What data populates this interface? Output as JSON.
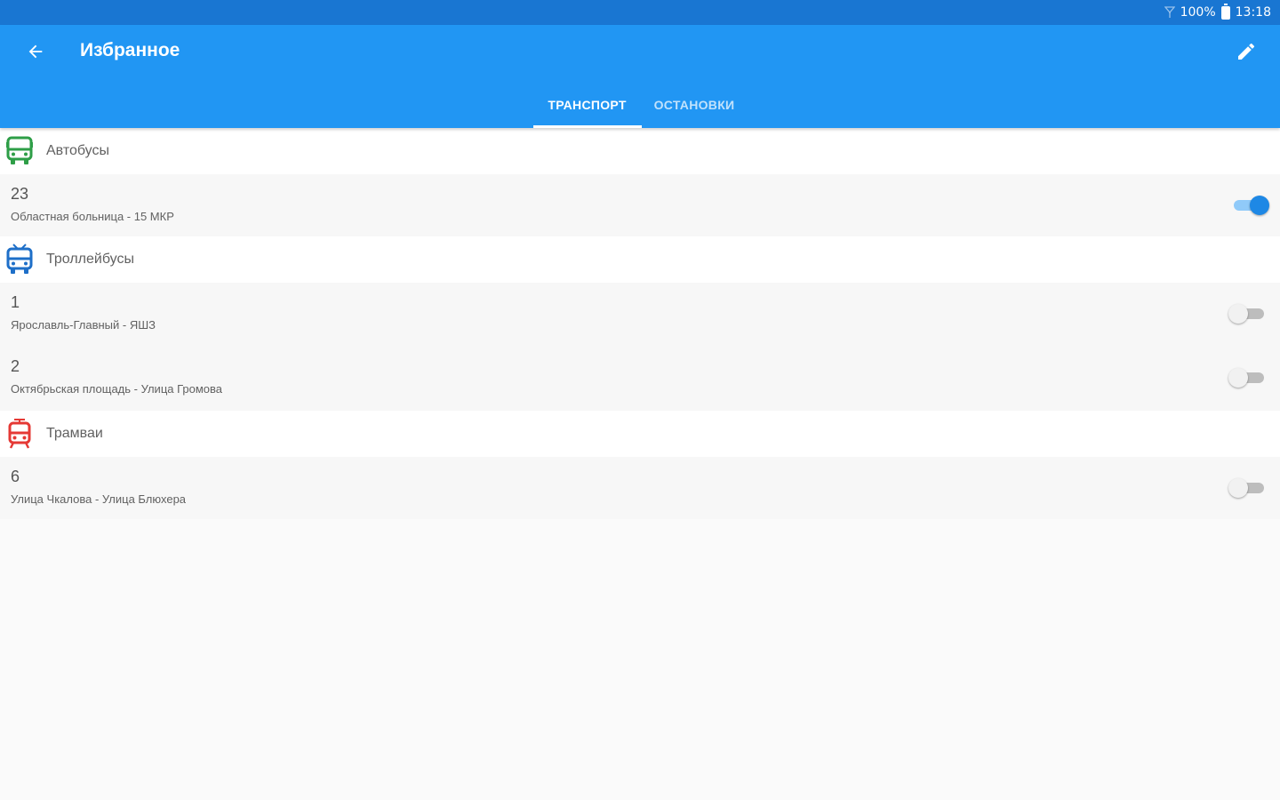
{
  "status_bar": {
    "battery": "100%",
    "time": "13:18",
    "icons": [
      "signal-icon",
      "battery-icon"
    ]
  },
  "app_bar": {
    "title": "Избранное",
    "back_icon": "arrow-back-icon",
    "edit_icon": "pencil-icon",
    "background": "#2196f3",
    "status_background": "#1976d2"
  },
  "tabs": [
    {
      "label": "ТРАНСПОРТ",
      "active": true
    },
    {
      "label": "ОСТАНОВКИ",
      "active": false
    }
  ],
  "sections": [
    {
      "label": "Автобусы",
      "icon": "bus-icon",
      "icon_color": "#2e9e47",
      "routes": [
        {
          "number": "23",
          "name": "Областная больница - 15 МКР",
          "enabled": true
        }
      ]
    },
    {
      "label": "Троллейбусы",
      "icon": "trolleybus-icon",
      "icon_color": "#1e6fc8",
      "routes": [
        {
          "number": "1",
          "name": "Ярославль-Главный - ЯШЗ",
          "enabled": false
        },
        {
          "number": "2",
          "name": "Октябрьская площадь - Улица Громова",
          "enabled": false
        }
      ]
    },
    {
      "label": "Трамваи",
      "icon": "tram-icon",
      "icon_color": "#e53935",
      "routes": [
        {
          "number": "6",
          "name": "Улица Чкалова - Улица Блюхера",
          "enabled": false
        }
      ]
    }
  ]
}
